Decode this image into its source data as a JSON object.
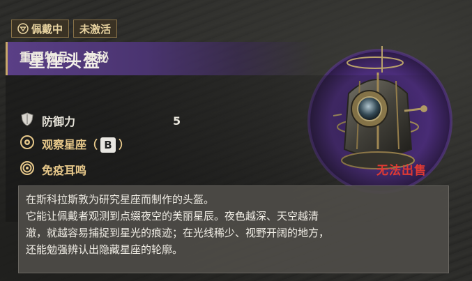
{
  "badges": {
    "equipped": "佩戴中",
    "inactive": "未激活"
  },
  "item": {
    "name": "星座头盔",
    "category": "重要物品 | 神秘",
    "stats": [
      {
        "label": "防御力",
        "value": "5",
        "icon": "shield-icon"
      }
    ],
    "abilities": [
      {
        "label_prefix": "观察星座（",
        "key": "B",
        "label_suffix": "）",
        "icon": "eye-ring-icon"
      },
      {
        "label": "免疫耳鸣",
        "icon": "concentric-rings-icon"
      }
    ],
    "sell_status": "无法出售",
    "description": [
      "在斯科拉斯敦为研究星座而制作的头盔。",
      "它能让佩戴者观测到点缀夜空的美丽星辰。夜色越深、天空越清",
      "澈，就越容易捕捉到星光的痕迹；在光线稀少、视野开阔的地方，",
      "还能勉强辨认出隐藏星座的轮廓。"
    ]
  },
  "colors": {
    "title_bar": "#5a3f86",
    "gold": "#e7c88a",
    "warning_red": "#e03a33"
  }
}
